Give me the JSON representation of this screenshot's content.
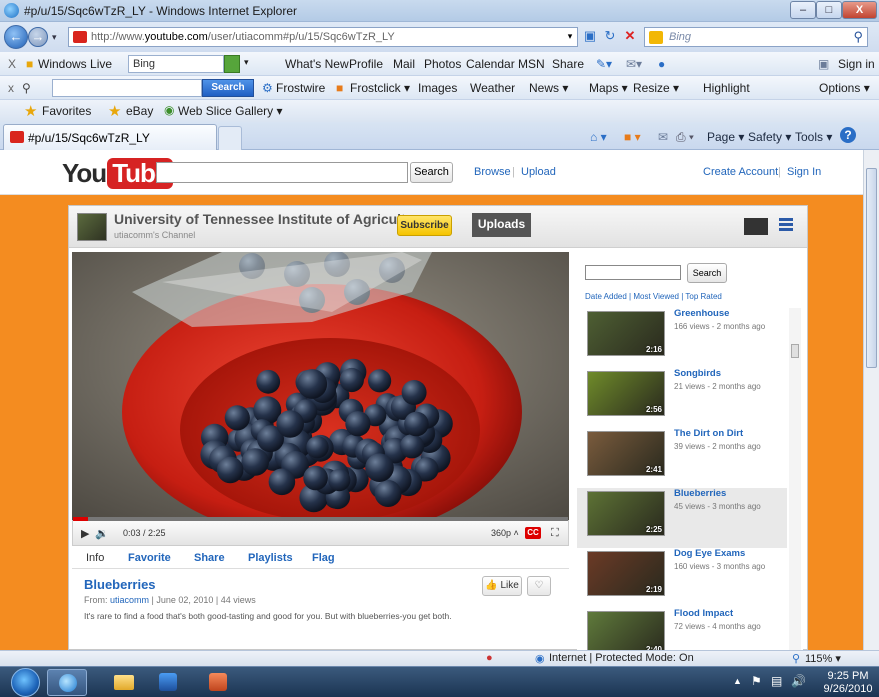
{
  "window": {
    "title": "#p/u/15/Sqc6wTzR_LY - Windows Internet Explorer",
    "minimize_glyph": "–",
    "maximize_glyph": "□",
    "close_glyph": "X"
  },
  "address_bar": {
    "url_prefix": "http://www.",
    "url_domain": "youtube.com",
    "url_path": "/user/utiacomm#p/u/15/Sqc6wTzR_LY",
    "search_placeholder": "Bing"
  },
  "live_toolbar": {
    "close_glyph": "X",
    "brand": "Windows Live",
    "search_value": "Bing",
    "items": [
      "What's New",
      "Profile",
      "Mail",
      "Photos",
      "Calendar",
      "MSN",
      "Share"
    ],
    "sign_in": "Sign in"
  },
  "toolbar2": {
    "close_glyph": "x",
    "search_btn": "Search",
    "items": [
      "Frostwire",
      "Frostclick ▾",
      "Images",
      "Weather",
      "News ▾",
      "Maps ▾",
      "Resize ▾",
      "Highlight"
    ],
    "options": "Options ▾"
  },
  "favorites_bar": {
    "favorites": "Favorites",
    "ebay": "eBay",
    "web_slice": "Web Slice Gallery ▾"
  },
  "tab": {
    "label": "#p/u/15/Sqc6wTzR_LY"
  },
  "command_bar": {
    "page": "Page ▾",
    "safety": "Safety ▾",
    "tools": "Tools ▾",
    "help_glyph": "?"
  },
  "youtube": {
    "logo_you": "You",
    "logo_tube": "Tube",
    "search_btn": "Search",
    "browse": "Browse",
    "upload": "Upload",
    "create_account": "Create Account",
    "sign_in": "Sign In"
  },
  "channel": {
    "title": "University of Tennessee Institute of Agriculture",
    "subtitle": "utiacomm's Channel",
    "subscribe": "Subscribe",
    "uploads": "Uploads"
  },
  "player": {
    "time": "0:03 / 2:25",
    "quality": "360p ˄",
    "cc": "CC",
    "progress_fraction": 0.02
  },
  "info_tabs": {
    "info": "Info",
    "favorite": "Favorite",
    "share": "Share",
    "playlists": "Playlists",
    "flag": "Flag"
  },
  "video": {
    "title": "Blueberries",
    "from_label": "From:",
    "author": "utiacomm",
    "meta_rest": " | June 02, 2010 | 44 views",
    "description": "It's rare to find a food that's both good-tasting and good for you. But with blueberries-you get both.",
    "like": "Like"
  },
  "sidebar": {
    "search_btn": "Search",
    "sort_links": "Date Added | Most Viewed | Top Rated",
    "videos": [
      {
        "title": "Greenhouse",
        "sub": "166 views - 2 months ago",
        "duration": "2:16",
        "selected": false,
        "color": "#4e5f33"
      },
      {
        "title": "Songbirds",
        "sub": "21 views - 2 months ago",
        "duration": "2:56",
        "selected": false,
        "color": "#6f8b2a"
      },
      {
        "title": "The Dirt on Dirt",
        "sub": "39 views - 2 months ago",
        "duration": "2:41",
        "selected": false,
        "color": "#7a5b3d"
      },
      {
        "title": "Blueberries",
        "sub": "45 views - 3 months ago",
        "duration": "2:25",
        "selected": true,
        "color": "#5d7235"
      },
      {
        "title": "Dog Eye Exams",
        "sub": "160 views - 3 months ago",
        "duration": "2:19",
        "selected": false,
        "color": "#6b3a26"
      },
      {
        "title": "Flood Impact",
        "sub": "72 views - 4 months ago",
        "duration": "2:40",
        "selected": false,
        "color": "#5f7a3b"
      }
    ]
  },
  "statusbar": {
    "zone": "Internet | Protected Mode: On",
    "zoom": "115%  ▾"
  },
  "taskbar": {
    "time": "9:25 PM",
    "date": "9/26/2010"
  }
}
